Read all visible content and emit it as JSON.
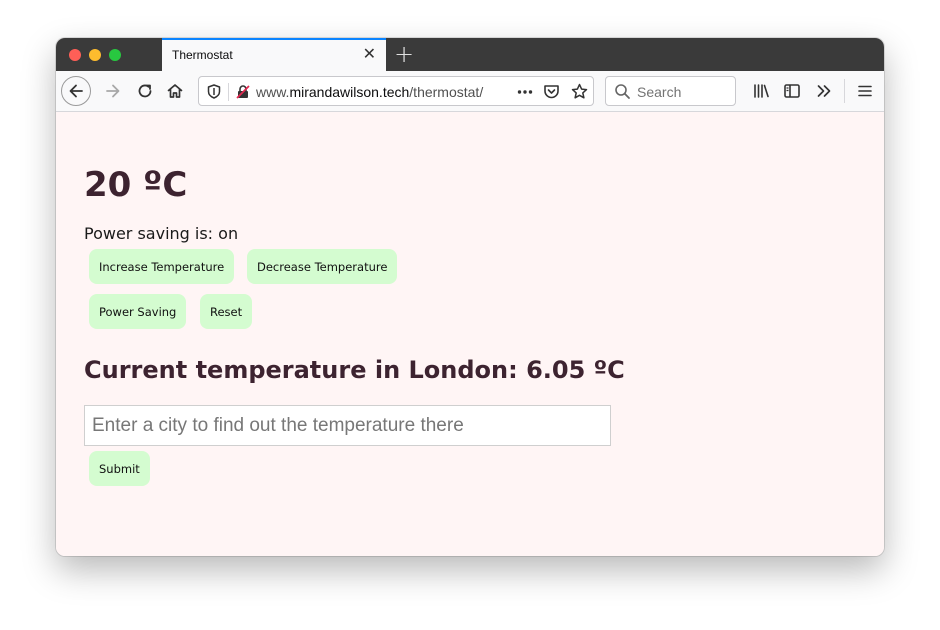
{
  "browser": {
    "tab_title": "Thermostat",
    "tab_close_glyph": "✕",
    "new_tab_glyph": "+",
    "url_prefix": "www.",
    "url_domain": "mirandawilson.tech",
    "url_path": "/thermostat/",
    "search_placeholder": "Search",
    "accent_color": "#0a84ff"
  },
  "icons": {
    "back": "back-arrow-icon",
    "forward": "forward-arrow-icon",
    "reload": "reload-icon",
    "home": "home-icon",
    "shield": "tracking-protection-shield-icon",
    "insecure": "insecure-lock-icon",
    "page_actions": "ellipsis-icon",
    "pocket": "pocket-icon",
    "bookmark": "star-icon",
    "search": "magnifier-icon",
    "library": "library-icon",
    "sidebar": "sidebar-icon",
    "overflow": "double-chevron-icon",
    "menu": "hamburger-menu-icon"
  },
  "page": {
    "background_color": "#fff5f5",
    "heading_color": "#3d2330",
    "button_color": "#d4fcd0",
    "temperature_display": "20 ºC",
    "power_saving_text": "Power saving is: on",
    "buttons": {
      "increase": "Increase Temperature",
      "decrease": "Decrease Temperature",
      "power_saving": "Power Saving",
      "reset": "Reset",
      "submit": "Submit"
    },
    "city_temperature_heading": "Current temperature in London: 6.05 ºC",
    "city_input_placeholder": "Enter a city to find out the temperature there",
    "city_input_value": ""
  }
}
